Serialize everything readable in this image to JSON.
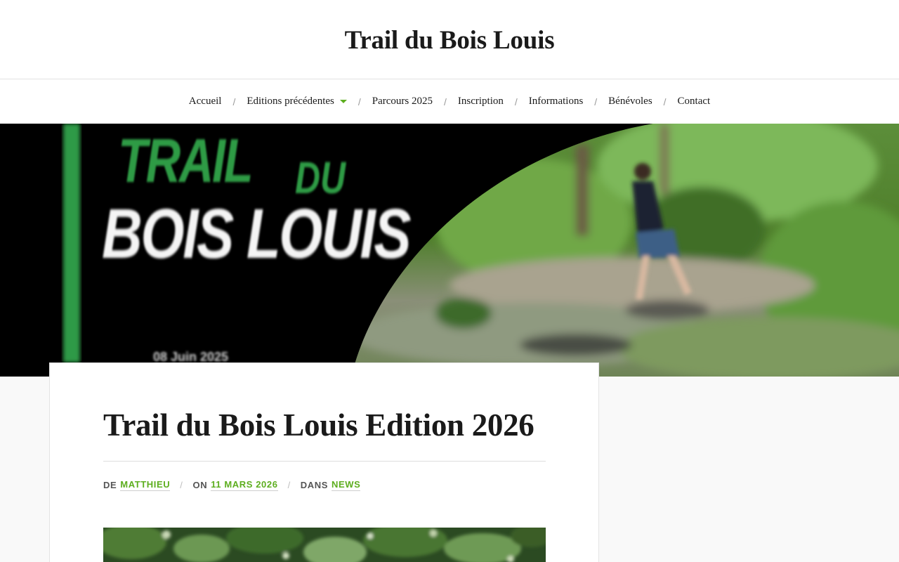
{
  "site": {
    "title": "Trail du Bois Louis"
  },
  "nav": {
    "items": [
      {
        "label": "Accueil"
      },
      {
        "label": "Editions précédentes",
        "has_submenu": true
      },
      {
        "label": "Parcours 2025"
      },
      {
        "label": "Inscription"
      },
      {
        "label": "Informations"
      },
      {
        "label": "Bénévoles"
      },
      {
        "label": "Contact"
      }
    ],
    "separator": "/"
  },
  "hero": {
    "line1": "TRAIL",
    "line1_small": "DU",
    "line2": "BOIS LOUIS",
    "date": "08 Juin 2025"
  },
  "post": {
    "title": "Trail du Bois Louis Edition 2026",
    "meta": {
      "author_label": "De",
      "author": "Matthieu",
      "date_label": "On",
      "date": "11 mars 2026",
      "category_label": "Dans",
      "category": "News"
    }
  },
  "colors": {
    "accent": "#5dae1f",
    "header_bg": "#ffffff",
    "page_bg": "#f9f9f9",
    "text": "#1a1a1a"
  }
}
